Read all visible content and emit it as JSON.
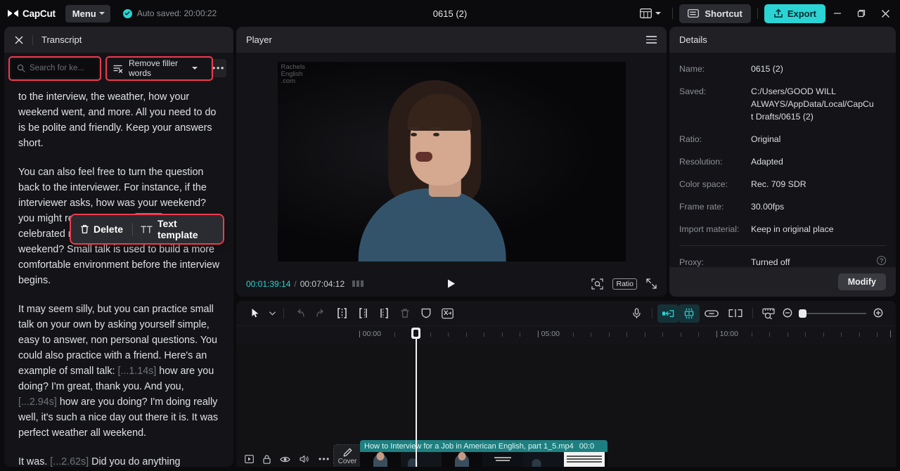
{
  "topbar": {
    "logo_text": "CapCut",
    "menu_label": "Menu",
    "autosave_text": "Auto saved: 20:00:22",
    "project_title": "0615 (2)",
    "shortcut_label": "Shortcut",
    "export_label": "Export",
    "icons": {
      "layout": "layout-icon",
      "layout_caret": "chevron-down-icon",
      "shortcut": "keyboard-icon",
      "export": "upload-icon",
      "minimize": "minimize-icon",
      "maximize": "maximize-icon",
      "close": "close-icon"
    }
  },
  "transcript": {
    "title": "Transcript",
    "close_icon": "close-icon",
    "search_placeholder": "Search for ke...",
    "search_value": "",
    "search_icon": "search-icon",
    "filler_label": "Remove filler words",
    "filler_icon": "filter-x-icon",
    "more_label": "•••",
    "paragraphs": [
      {
        "id": "p1",
        "runs": [
          {
            "type": "text",
            "text": "to the interview, the weather, how your weekend went, and more. All you need to do is be polite and friendly. Keep your answers short."
          }
        ]
      },
      {
        "id": "p2",
        "runs": [
          {
            "type": "text",
            "text": "You can also feel free to turn the question back to the interviewer. For instance, if the interviewer asks, how was your weekend? you might respond, it was "
          },
          {
            "type": "highlight",
            "text": "great!"
          },
          {
            "type": "text",
            "text": " We celebrated my mom's birthday. How is your weekend? Small talk is used to build a more comfortable environment before the interview begins."
          }
        ]
      },
      {
        "id": "p3",
        "runs": [
          {
            "type": "text",
            "text": "It may seem silly, but you can practice small talk on your own by asking yourself simple, easy to answer, non personal questions. You could also practice with a friend. Here's an example of small talk: "
          },
          {
            "type": "gap",
            "text": "[...1.14s]"
          },
          {
            "type": "text",
            "text": " how are you doing? I'm great, thank you. And you, "
          },
          {
            "type": "gap",
            "text": "[...2.94s]"
          },
          {
            "type": "text",
            "text": " how are you doing? I'm doing really well, it's such a nice day out there it is. It was perfect weather all weekend."
          }
        ]
      },
      {
        "id": "p4",
        "runs": [
          {
            "type": "text",
            "text": "It was. "
          },
          {
            "type": "gap",
            "text": "[...2.62s]"
          },
          {
            "type": "text",
            "text": " Did you do anything"
          }
        ]
      }
    ],
    "context_menu": {
      "delete_label": "Delete",
      "delete_icon": "trash-icon",
      "text_template_label": "Text template",
      "text_template_icon": "text-template-icon"
    }
  },
  "player": {
    "title": "Player",
    "menu_icon": "hamburger-icon",
    "watermark": "Rachels\nEnglish\n.com",
    "watermark_lines": [
      "Rachels",
      "English",
      ".com"
    ],
    "current_time": "00:01:39:14",
    "total_time": "00:07:04:12",
    "separator": "/",
    "keyframe_icon": "keyframe-icon",
    "play_icon": "play-icon",
    "crop_icon": "crop-focus-icon",
    "ratio_label": "Ratio",
    "fullscreen_icon": "fullscreen-icon"
  },
  "details": {
    "title": "Details",
    "rows": [
      {
        "key": "Name:",
        "value": "0615 (2)"
      },
      {
        "key": "Saved:",
        "value": "C:/Users/GOOD WILL ALWAYS/AppData/Local/CapCut Drafts/0615 (2)"
      },
      {
        "key": "Ratio:",
        "value": "Original"
      },
      {
        "key": "Resolution:",
        "value": "Adapted"
      },
      {
        "key": "Color space:",
        "value": "Rec. 709 SDR"
      },
      {
        "key": "Frame rate:",
        "value": "30.00fps"
      },
      {
        "key": "Import material:",
        "value": "Keep in original place"
      }
    ],
    "proxy": {
      "key": "Proxy:",
      "value": "Turned off",
      "help_icon": "question-circle-icon"
    },
    "modify_label": "Modify"
  },
  "timeline": {
    "tools_left": [
      {
        "name": "select-tool-icon",
        "label": "select",
        "state": "normal"
      },
      {
        "name": "chevron-down-icon",
        "label": "select-dropdown",
        "state": "normal"
      },
      {
        "name": "undo-icon",
        "label": "undo",
        "state": "dim"
      },
      {
        "name": "redo-icon",
        "label": "redo",
        "state": "dim"
      },
      {
        "name": "split-icon",
        "label": "split",
        "state": "normal"
      },
      {
        "name": "trim-left-icon",
        "label": "delete-left",
        "state": "normal"
      },
      {
        "name": "trim-right-icon",
        "label": "delete-right",
        "state": "normal"
      },
      {
        "name": "trash-icon",
        "label": "delete",
        "state": "dim"
      },
      {
        "name": "shield-icon",
        "label": "freeze",
        "state": "normal"
      },
      {
        "name": "mute-clip-icon",
        "label": "separate-audio",
        "state": "normal"
      }
    ],
    "tools_right": [
      {
        "name": "microphone-icon",
        "label": "record",
        "state": "normal"
      },
      {
        "name": "snap-left-icon",
        "label": "auto-fit",
        "state": "active"
      },
      {
        "name": "keyframe-burst-icon",
        "label": "beat-detect",
        "state": "active"
      },
      {
        "name": "link-icon",
        "label": "link-clips",
        "state": "normal"
      },
      {
        "name": "split-lines-icon",
        "label": "magnet",
        "state": "normal"
      },
      {
        "name": "ruler-zoom-icon",
        "label": "zoom-to-fit",
        "state": "normal"
      },
      {
        "name": "zoom-out-icon",
        "label": "zoom-out",
        "state": "normal"
      },
      {
        "name": "zoom-in-icon",
        "label": "zoom-in",
        "state": "normal"
      }
    ],
    "zoom_value": 4,
    "ruler_labels": [
      "| 00:00",
      "| 05:00",
      "| 10:00"
    ],
    "track_header_icons": [
      {
        "name": "preview-toggle-icon",
        "label": "preview"
      },
      {
        "name": "lock-icon",
        "label": "lock"
      },
      {
        "name": "eye-icon",
        "label": "visibility"
      },
      {
        "name": "speaker-icon",
        "label": "mute"
      },
      {
        "name": "more-icon",
        "label": "more"
      }
    ],
    "cover_label": "Cover",
    "cover_icon": "pencil-icon",
    "clip": {
      "name": "How to Interview for a Job in American English, part 1_5.mp4",
      "duration_label": "00:0"
    }
  },
  "colors": {
    "accent": "#2ad4d4",
    "highlight_red": "#f03a4e",
    "clip_teal": "#1d7f80",
    "panel_bg": "#141418",
    "header_bg": "#202025"
  }
}
